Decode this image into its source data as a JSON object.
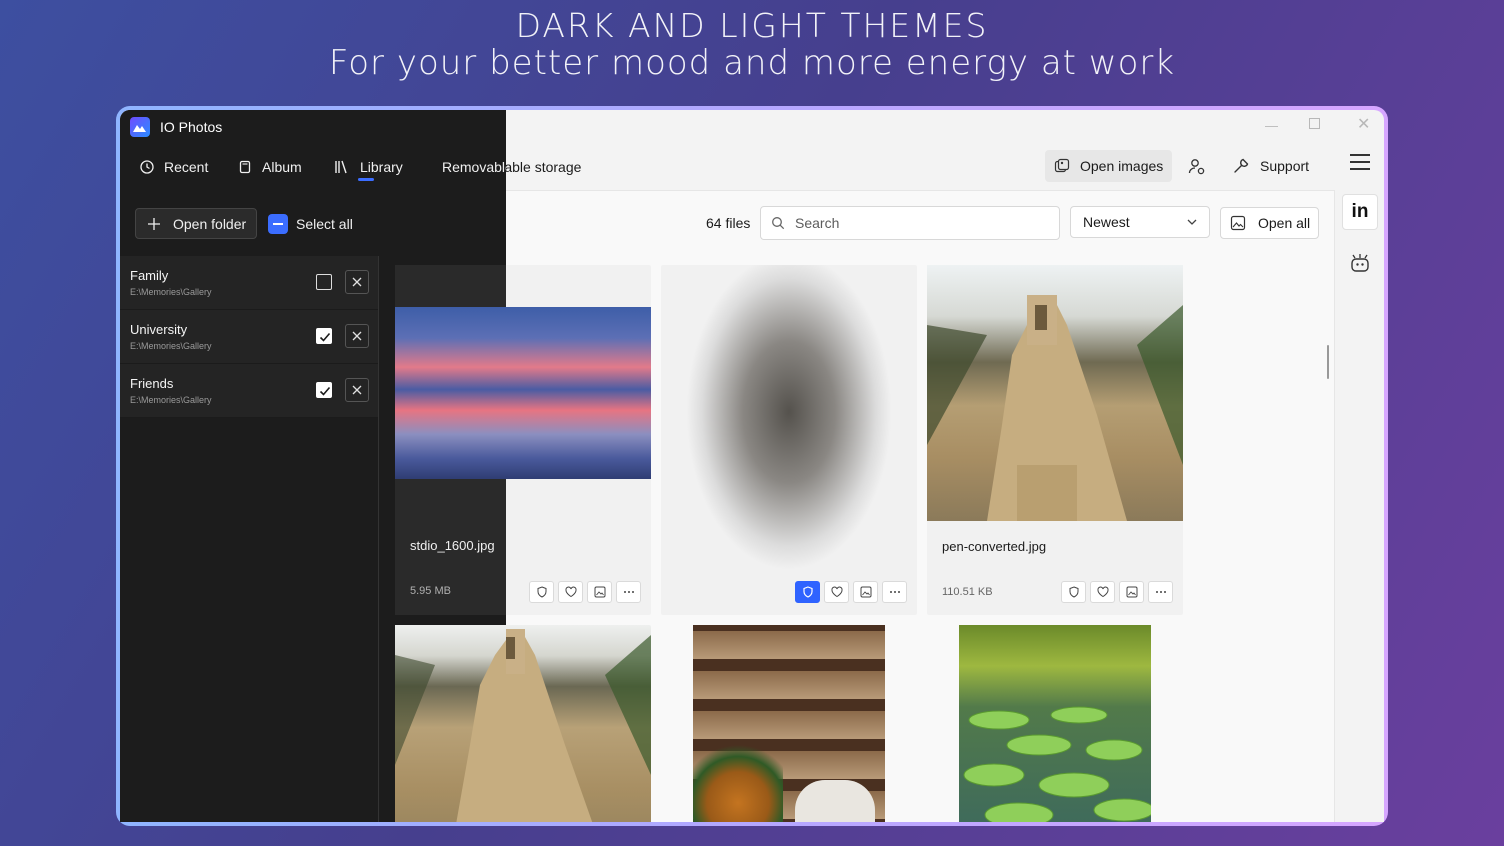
{
  "promo": {
    "headline": "DARK AND LIGHT THEMES",
    "subheadline": "For your better mood and more energy at work"
  },
  "app": {
    "title": "IO Photos",
    "nav": [
      "Recent",
      "Album",
      "Library",
      "Removable storage"
    ],
    "active_nav": "Library"
  },
  "toolbar": {
    "open_images": "Open images",
    "support": "Support"
  },
  "sidebar": {
    "open_folder": "Open folder",
    "select_all": "Select all",
    "folders": [
      {
        "name": "Family",
        "path": "E:\\Memories\\Gallery",
        "checked": false
      },
      {
        "name": "University",
        "path": "E:\\Memories\\Gallery",
        "checked": true
      },
      {
        "name": "Friends",
        "path": "E:\\Memories\\Gallery",
        "checked": true
      }
    ]
  },
  "gallery": {
    "count": "64 files",
    "search_placeholder": "Search",
    "sort": "Newest",
    "open_all": "Open all",
    "cards": [
      {
        "name": "stdio_1600.jpg",
        "size": "5.95 MB",
        "protected": false
      },
      {
        "name": "",
        "size": "",
        "protected": true
      },
      {
        "name": "pen-converted.jpg",
        "size": "110.51 KB",
        "protected": false
      }
    ]
  },
  "rail": {
    "linkedin": "in"
  },
  "colors": {
    "accent": "#2f63ff",
    "dark_bg": "#1c1c1c",
    "light_bg": "#f3f3f3"
  }
}
